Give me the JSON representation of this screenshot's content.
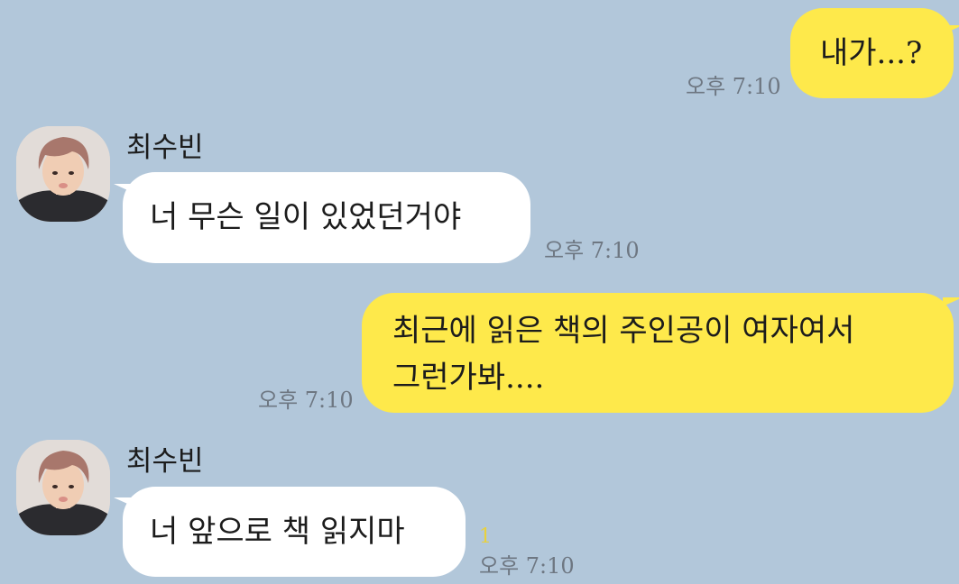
{
  "colors": {
    "background": "#b2c7da",
    "my_bubble": "#fee94b",
    "other_bubble": "#ffffff",
    "timestamp": "#6e7782",
    "unread_count": "#e9d13d"
  },
  "messages": [
    {
      "sender": "me",
      "text": "내가...?",
      "time": "오후 7:10"
    },
    {
      "sender": "최수빈",
      "avatar": "profile-photo",
      "text": "너 무슨 일이 있었던거야",
      "time": "오후 7:10"
    },
    {
      "sender": "me",
      "lines": [
        "최근에 읽은 책의 주인공이 여자여서",
        "그런가봐...."
      ],
      "time": "오후 7:10"
    },
    {
      "sender": "최수빈",
      "avatar": "profile-photo",
      "text": "너 앞으로 책 읽지마",
      "time": "오후 7:10",
      "unread": "1"
    }
  ]
}
